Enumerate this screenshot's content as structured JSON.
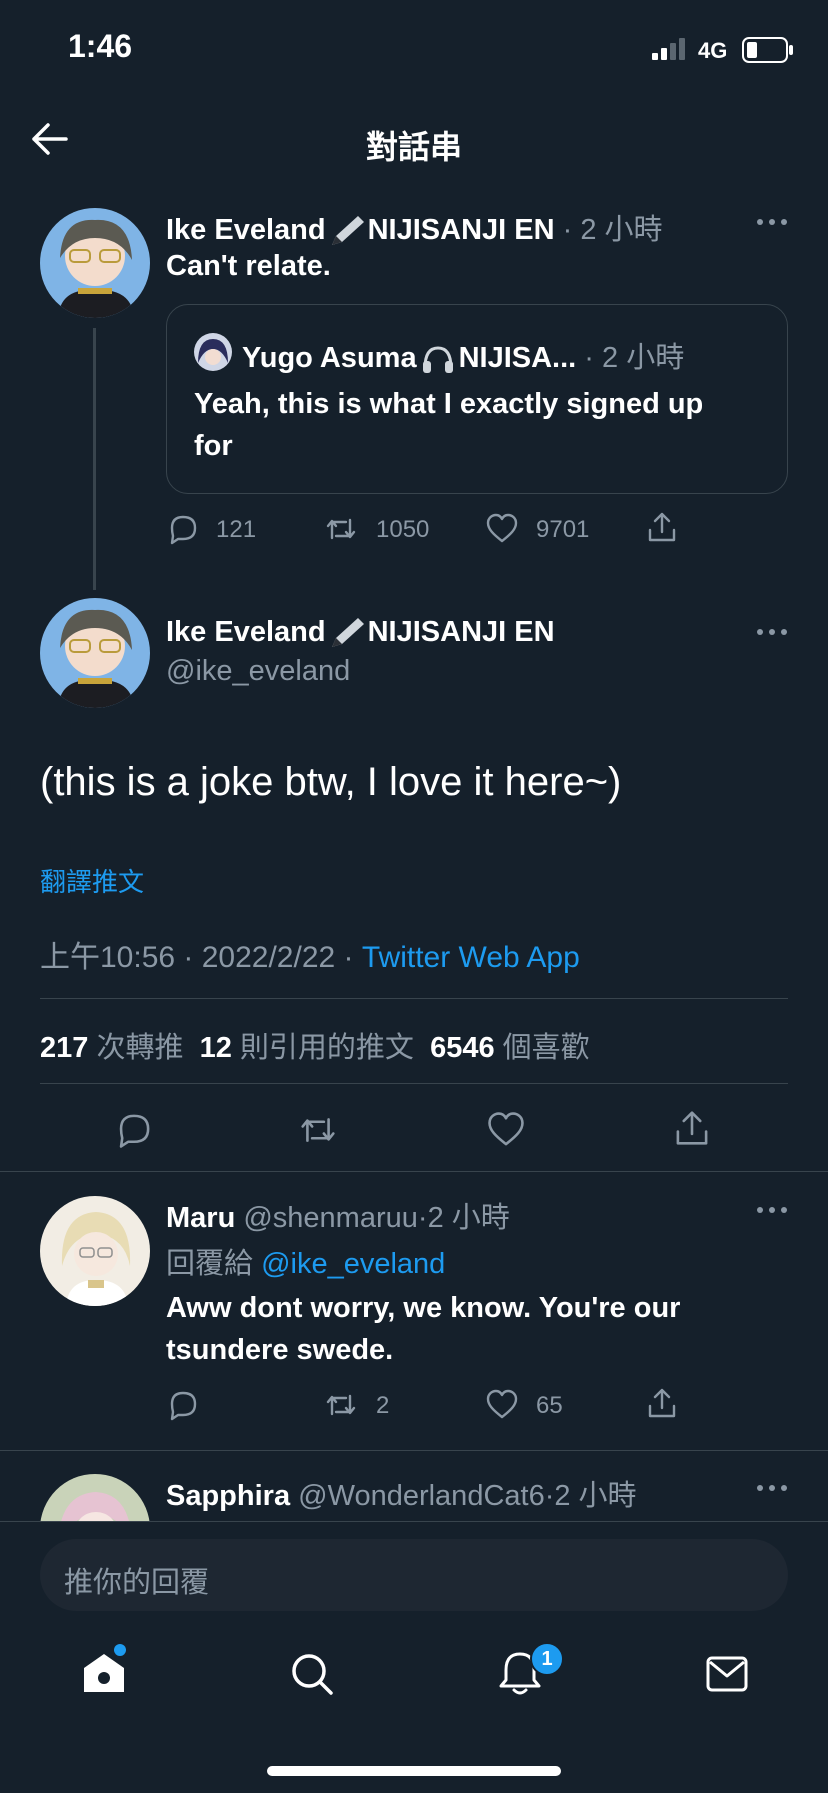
{
  "status_bar": {
    "time": "1:46",
    "network": "4G"
  },
  "header": {
    "title": "對話串"
  },
  "tweet1": {
    "author": "Ike Eveland",
    "author_suffix": "NIJISANJI EN",
    "sep": "·",
    "time": "2 小時",
    "text": "Can't relate.",
    "quote": {
      "author": "Yugo Asuma",
      "author_suffix": "NIJISA...",
      "time": "2 小時",
      "text_line1": "Yeah, this is what I exactly signed up",
      "text_line2": "for"
    },
    "stats": {
      "replies": "121",
      "retweets": "1050",
      "likes": "9701"
    }
  },
  "main_tweet": {
    "author": "Ike Eveland",
    "author_suffix": "NIJISANJI EN",
    "handle": "@ike_eveland",
    "text": "(this is a joke btw, I love it here~)",
    "translate": "翻譯推文",
    "timestamp": "上午10:56 · 2022/2/22 ·",
    "source": "Twitter Web App",
    "retweets_count": "217",
    "retweets_label": "次轉推",
    "quotes_count": "12",
    "quotes_label": "則引用的推文",
    "likes_count": "6546",
    "likes_label": "個喜歡"
  },
  "reply1": {
    "author": "Maru",
    "handle": "@shenmaruu",
    "sep": "·",
    "time": "2 小時",
    "reply_to_label": "回覆給",
    "reply_to": "@ike_eveland",
    "text_line1": "Aww dont worry, we know. You're our",
    "text_line2": "tsundere swede.",
    "stats": {
      "retweets": "2",
      "likes": "65"
    }
  },
  "reply2": {
    "author": "Sapphira",
    "handle": "@WonderlandCat6",
    "sep": "·",
    "time": "2 小時"
  },
  "composer": {
    "placeholder": "推你的回覆"
  },
  "nav": {
    "notification_badge": "1"
  },
  "colors": {
    "background": "#15202b",
    "accent": "#1d9bf0",
    "secondary_text": "#8b98a5",
    "divider": "#38444d"
  }
}
